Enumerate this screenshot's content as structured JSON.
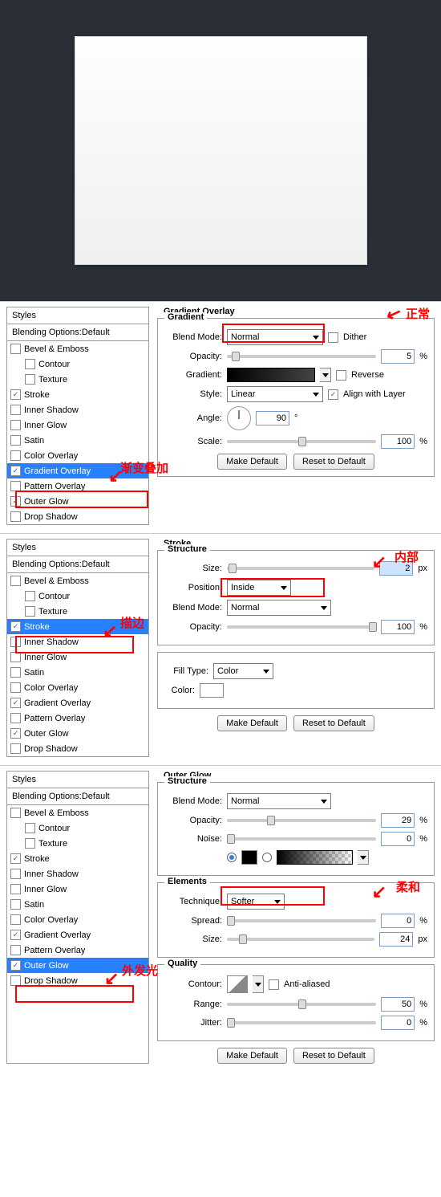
{
  "styles_header": "Styles",
  "blending_options": "Blending Options:Default",
  "effects": {
    "bevel": "Bevel & Emboss",
    "contour": "Contour",
    "texture": "Texture",
    "stroke": "Stroke",
    "inner_shadow": "Inner Shadow",
    "inner_glow": "Inner Glow",
    "satin": "Satin",
    "color_overlay": "Color Overlay",
    "gradient_overlay": "Gradient Overlay",
    "pattern_overlay": "Pattern Overlay",
    "outer_glow": "Outer Glow",
    "drop_shadow": "Drop Shadow"
  },
  "buttons": {
    "make_default": "Make Default",
    "reset_default": "Reset to Default"
  },
  "panel1": {
    "title": "Gradient Overlay",
    "section": "Gradient",
    "blend_mode_label": "Blend Mode:",
    "blend_mode_value": "Normal",
    "dither": "Dither",
    "opacity_label": "Opacity:",
    "opacity_value": "5",
    "pct": "%",
    "gradient_label": "Gradient:",
    "reverse": "Reverse",
    "style_label": "Style:",
    "style_value": "Linear",
    "align": "Align with Layer",
    "angle_label": "Angle:",
    "angle_value": "90",
    "deg": "°",
    "scale_label": "Scale:",
    "scale_value": "100",
    "annot_normal": "正常",
    "annot_gradient": "渐变叠加"
  },
  "panel2": {
    "title": "Stroke",
    "section": "Structure",
    "size_label": "Size:",
    "size_value": "2",
    "px": "px",
    "position_label": "Position:",
    "position_value": "Inside",
    "blend_mode_label": "Blend Mode:",
    "blend_mode_value": "Normal",
    "opacity_label": "Opacity:",
    "opacity_value": "100",
    "pct": "%",
    "fill_type_label": "Fill Type:",
    "fill_type_value": "Color",
    "color_label": "Color:",
    "annot_stroke": "描边",
    "annot_inside": "内部"
  },
  "panel3": {
    "title": "Outer Glow",
    "section1": "Structure",
    "blend_mode_label": "Blend Mode:",
    "blend_mode_value": "Normal",
    "opacity_label": "Opacity:",
    "opacity_value": "29",
    "pct": "%",
    "noise_label": "Noise:",
    "noise_value": "0",
    "section2": "Elements",
    "technique_label": "Technique:",
    "technique_value": "Softer",
    "spread_label": "Spread:",
    "spread_value": "0",
    "size_label": "Size:",
    "size_value": "24",
    "px": "px",
    "section3": "Quality",
    "contour_label": "Contour:",
    "anti_aliased": "Anti-aliased",
    "range_label": "Range:",
    "range_value": "50",
    "jitter_label": "Jitter:",
    "jitter_value": "0",
    "annot_outer": "外发光",
    "annot_softer": "柔和"
  }
}
